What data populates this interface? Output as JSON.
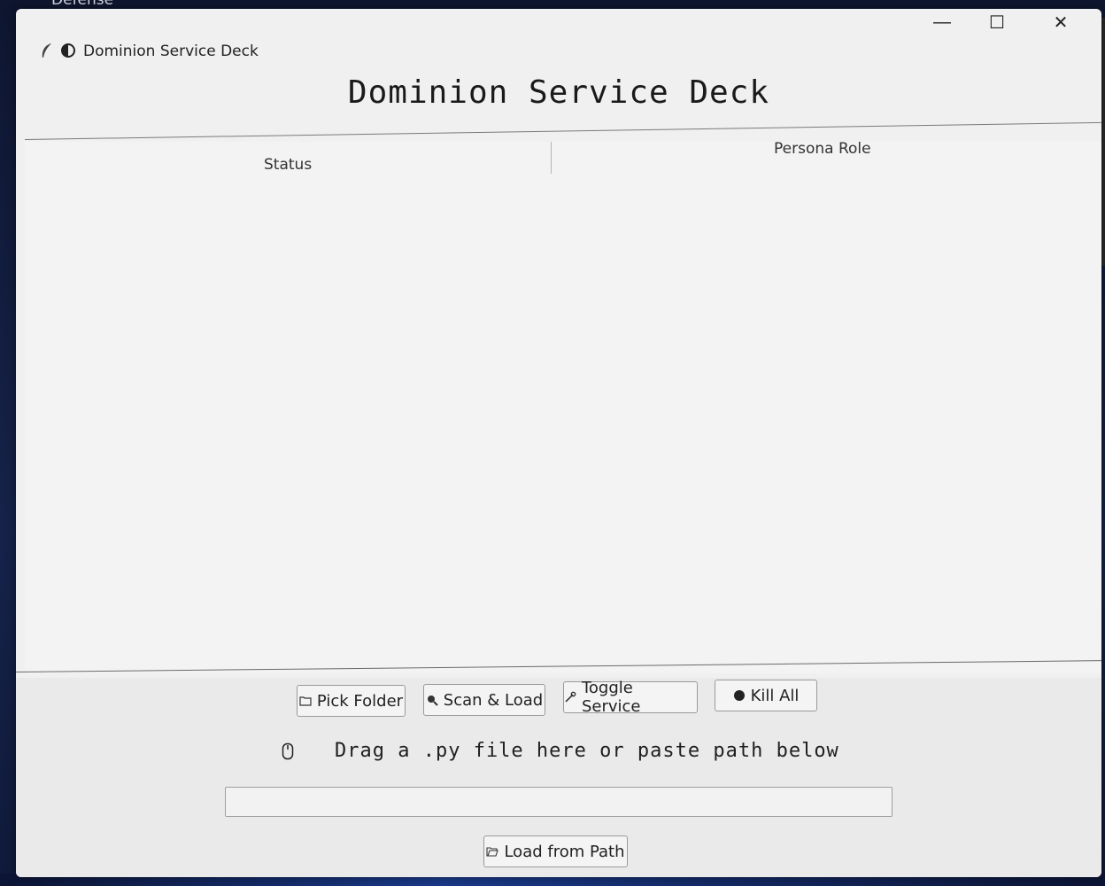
{
  "desktop": {
    "label": "Defense"
  },
  "window": {
    "title": "Dominion Service Deck",
    "controls": {
      "minimize": "—",
      "maximize": "☐",
      "close": "✕"
    }
  },
  "header": {
    "title": "Dominion Service Deck"
  },
  "tree": {
    "columns": [
      "Status",
      "Persona Role"
    ],
    "rows": []
  },
  "buttons": {
    "pick_folder": "Pick Folder",
    "scan_load": "Scan & Load",
    "toggle_service": "Toggle Service",
    "kill_all": "Kill All",
    "load_from_path": "Load from Path"
  },
  "drop_zone": {
    "text": "Drag a .py file here or paste path below"
  },
  "path_input": {
    "value": "",
    "placeholder": ""
  },
  "icons": {
    "app": [
      "feather-icon",
      "contrast-icon"
    ],
    "pick_folder": "folder-icon",
    "scan_load": "magnifier-icon",
    "toggle_service": "wrench-icon",
    "kill_all": "stop-icon",
    "drop_zone": "mouse-icon",
    "load_from_path": "open-folder-icon"
  }
}
